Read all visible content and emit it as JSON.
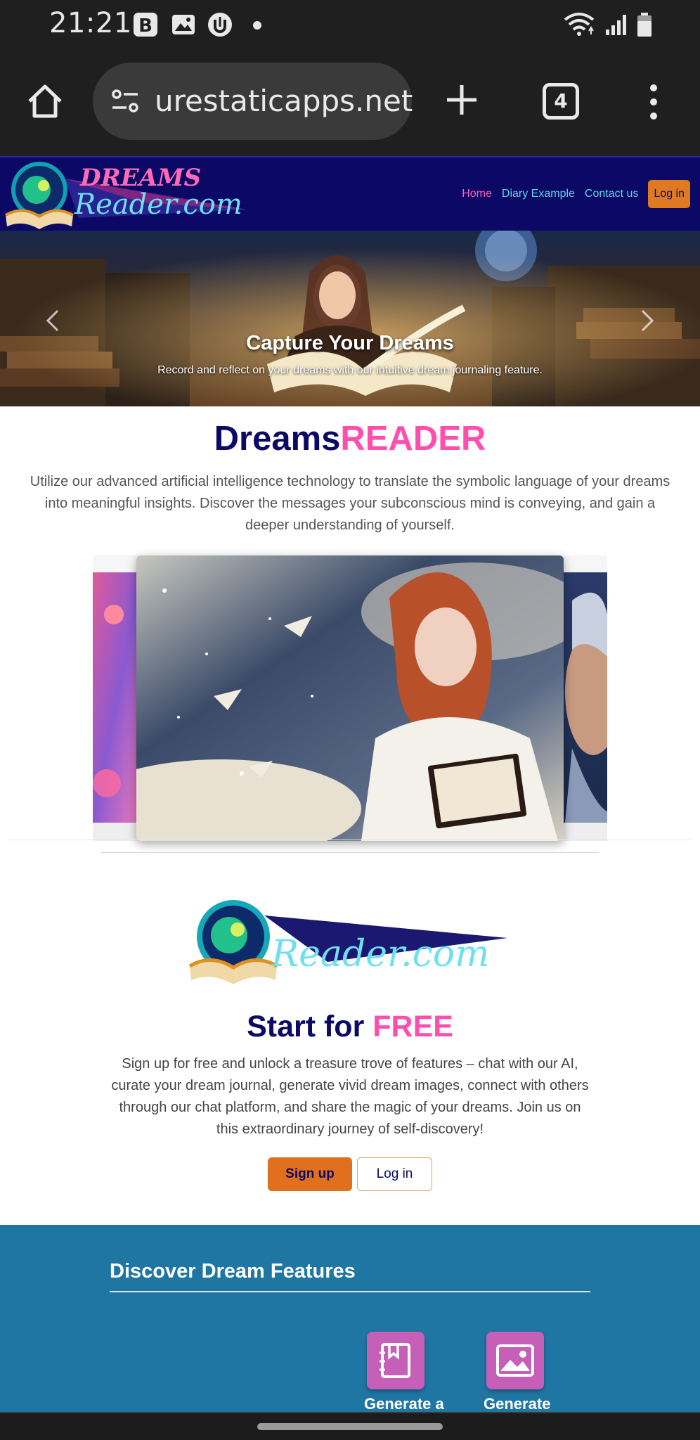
{
  "status_bar": {
    "time": "21:21",
    "icons": [
      "b-app-icon",
      "gallery-icon",
      "upload-icon",
      "wifi-icon",
      "signal-icon",
      "battery-icon"
    ]
  },
  "browser": {
    "url": "urestaticapps.net",
    "tab_count": "4"
  },
  "nav": {
    "brand": "DREAMS Reader.com",
    "links": [
      {
        "label": "Home",
        "active": true
      },
      {
        "label": "Diary Example",
        "active": false
      },
      {
        "label": "Contact us",
        "active": false
      }
    ],
    "login": "Log in"
  },
  "hero": {
    "title": "Capture Your Dreams",
    "caption": "Record and reflect on your dreams with our intuitive dream journaling feature."
  },
  "main": {
    "title_a": "Dreams",
    "title_b": "READER",
    "description": "Utilize our advanced artificial intelligence technology to translate the symbolic language of your dreams into meaningful insights. Discover the messages your subconscious mind is conveying, and gain a deeper understanding of yourself."
  },
  "promo": {
    "logo_text": "DREAMS Reader.com",
    "title_a": "Start for",
    "title_b": "FREE",
    "description": "Sign up for free and unlock a treasure trove of features – chat with our AI, curate your dream journal, generate vivid dream images, connect with others through our chat platform, and share the magic of your dreams. Join us on this extraordinary journey of self-discovery!",
    "signup": "Sign up",
    "login": "Log in"
  },
  "features": {
    "title": "Discover Dream Features",
    "items": [
      {
        "label": "Generate a",
        "icon": "journal-book-icon"
      },
      {
        "label": "Generate",
        "icon": "image-icon"
      }
    ]
  },
  "colors": {
    "nav_bg": "#0b0866",
    "accent_pink": "#ff4fae",
    "accent_cyan": "#5fd3e6",
    "cta_orange": "#e0701e",
    "features_bg": "#1f76a3"
  }
}
